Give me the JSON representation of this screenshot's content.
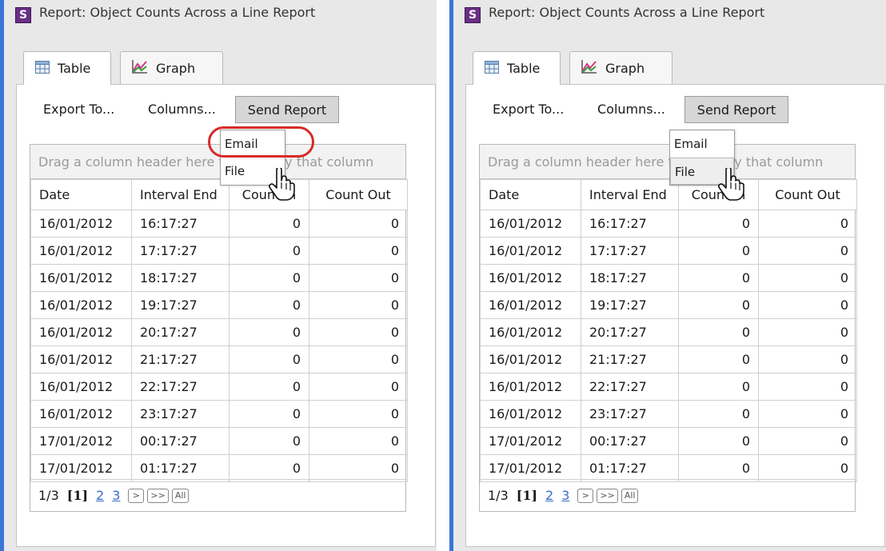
{
  "windows": [
    {
      "title": "Report: Object Counts Across a Line Report",
      "app_icon": "S",
      "tabs": [
        {
          "label": "Table"
        },
        {
          "label": "Graph"
        }
      ],
      "toolbar": {
        "export": "Export To...",
        "columns": "Columns...",
        "send": "Send Report"
      },
      "dropdown": {
        "email": "Email",
        "file": "File",
        "hovered": "none",
        "highlighted": "Email"
      },
      "grid": {
        "groupby_hint": "Drag a column header here to group by that column",
        "headers": [
          "Date",
          "Interval End",
          "Count In",
          "Count Out"
        ],
        "rows": [
          [
            "16/01/2012",
            "16:17:27",
            "0",
            "0"
          ],
          [
            "16/01/2012",
            "17:17:27",
            "0",
            "0"
          ],
          [
            "16/01/2012",
            "18:17:27",
            "0",
            "0"
          ],
          [
            "16/01/2012",
            "19:17:27",
            "0",
            "0"
          ],
          [
            "16/01/2012",
            "20:17:27",
            "0",
            "0"
          ],
          [
            "16/01/2012",
            "21:17:27",
            "0",
            "0"
          ],
          [
            "16/01/2012",
            "22:17:27",
            "0",
            "0"
          ],
          [
            "16/01/2012",
            "23:17:27",
            "0",
            "0"
          ],
          [
            "17/01/2012",
            "00:17:27",
            "0",
            "0"
          ],
          [
            "17/01/2012",
            "01:17:27",
            "0",
            "0"
          ]
        ]
      },
      "pager": {
        "summary": "1/3",
        "current": "[1]",
        "pages": [
          "2",
          "3"
        ],
        "next": ">",
        "last": ">>",
        "all": "All"
      }
    },
    {
      "title": "Report: Object Counts Across a Line Report",
      "app_icon": "S",
      "tabs": [
        {
          "label": "Table"
        },
        {
          "label": "Graph"
        }
      ],
      "toolbar": {
        "export": "Export To...",
        "columns": "Columns...",
        "send": "Send Report"
      },
      "dropdown": {
        "email": "Email",
        "file": "File",
        "hovered": "File",
        "highlighted": "none"
      },
      "grid": {
        "groupby_hint": "Drag a column header here to group by that column",
        "headers": [
          "Date",
          "Interval End",
          "Count In",
          "Count Out"
        ],
        "rows": [
          [
            "16/01/2012",
            "16:17:27",
            "0",
            "0"
          ],
          [
            "16/01/2012",
            "17:17:27",
            "0",
            "0"
          ],
          [
            "16/01/2012",
            "18:17:27",
            "0",
            "0"
          ],
          [
            "16/01/2012",
            "19:17:27",
            "0",
            "0"
          ],
          [
            "16/01/2012",
            "20:17:27",
            "0",
            "0"
          ],
          [
            "16/01/2012",
            "21:17:27",
            "0",
            "0"
          ],
          [
            "16/01/2012",
            "22:17:27",
            "0",
            "0"
          ],
          [
            "16/01/2012",
            "23:17:27",
            "0",
            "0"
          ],
          [
            "17/01/2012",
            "00:17:27",
            "0",
            "0"
          ],
          [
            "17/01/2012",
            "01:17:27",
            "0",
            "0"
          ]
        ]
      },
      "pager": {
        "summary": "1/3",
        "current": "[1]",
        "pages": [
          "2",
          "3"
        ],
        "next": ">",
        "last": ">>",
        "all": "All"
      }
    }
  ],
  "colors": {
    "window_border": "#3c74d8",
    "highlight_ring": "#d82a2a",
    "app_icon_bg": "#6a2f86",
    "link": "#3a6ec6"
  }
}
